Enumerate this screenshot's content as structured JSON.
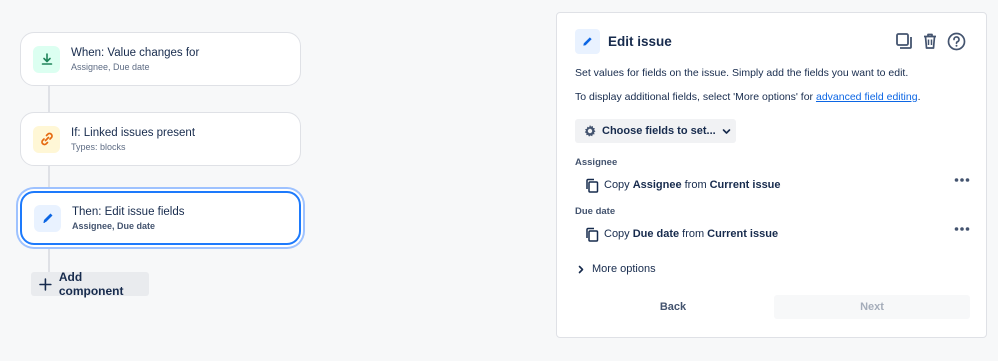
{
  "flow": {
    "components": [
      {
        "title": "When: Value changes for",
        "subtitle": "Assignee, Due date",
        "icon": "download-arrow-icon",
        "icon_bg": "#dcfff1",
        "icon_color": "#1f845a"
      },
      {
        "title": "If: Linked issues present",
        "subtitle": "Types: blocks",
        "icon": "link-icon",
        "icon_bg": "#fff7d6",
        "icon_color": "#e56910"
      },
      {
        "title": "Then: Edit issue fields",
        "subtitle": "Assignee, Due date",
        "icon": "pencil-icon",
        "icon_bg": "#e9f2ff",
        "icon_color": "#0c66e4"
      }
    ],
    "add_component_label": "Add component"
  },
  "panel": {
    "title": "Edit issue",
    "description": "Set values for fields on the issue. Simply add the fields you want to edit.",
    "additional_text": "To display additional fields, select 'More options' for",
    "advanced_link": "advanced field editing",
    "additional_suffix": ".",
    "choose_fields_label": "Choose fields to set...",
    "fields": [
      {
        "label": "Assignee",
        "copy": "Copy",
        "field": "Assignee",
        "from": "from",
        "source": "Current issue"
      },
      {
        "label": "Due date",
        "copy": "Copy",
        "field": "Due date",
        "from": "from",
        "source": "Current issue"
      }
    ],
    "more_options_label": "More options",
    "back_label": "Back",
    "next_label": "Next"
  },
  "colors": {
    "accent": "#1d7afc",
    "link": "#0c66e4",
    "text": "#172b4d"
  }
}
